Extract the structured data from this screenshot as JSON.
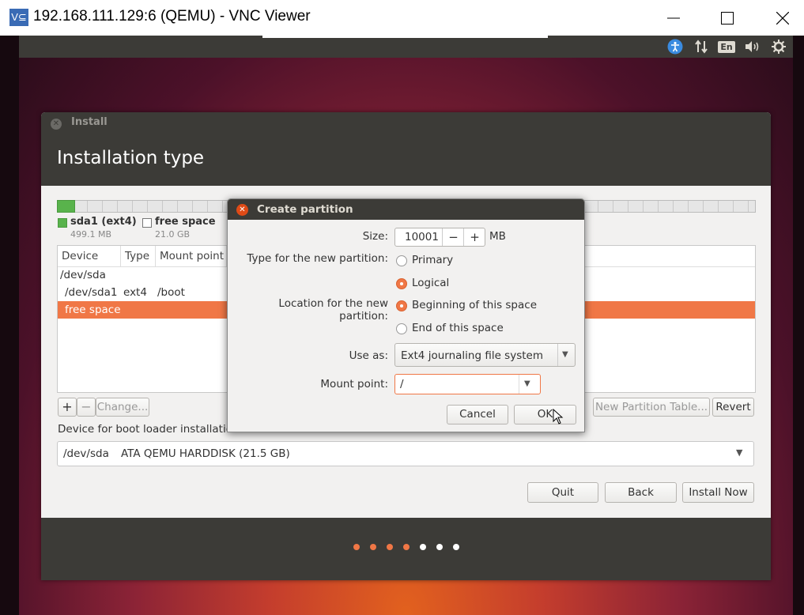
{
  "window": {
    "logo_text": "V⊆",
    "title": "192.168.111.129:6 (QEMU) - VNC Viewer"
  },
  "vm_topbar": {
    "icons": [
      "accessibility-icon",
      "network-icon",
      "keyboard-layout-icon",
      "volume-icon",
      "power-gear-icon"
    ],
    "keyboard_layout": "En"
  },
  "installer": {
    "window_title": "Install",
    "page_title": "Installation type",
    "disk_usage_fraction": 0.024,
    "legend": [
      {
        "name": "sda1 (ext4)",
        "size": "499.1 MB",
        "color": "#59b34c"
      },
      {
        "name": "free space",
        "size": "21.0 GB",
        "color": "#ffffff"
      }
    ],
    "table": {
      "headers": [
        "Device",
        "Type",
        "Mount point"
      ],
      "rows": [
        {
          "device": "/dev/sda",
          "type": "",
          "mount": ""
        },
        {
          "device": "/dev/sda1",
          "type": "ext4",
          "mount": "/boot"
        },
        {
          "device": "free space",
          "type": "",
          "mount": "",
          "selected": true
        }
      ]
    },
    "buttons": {
      "add": "+",
      "remove": "−",
      "change": "Change...",
      "new_partition_table": "New Partition Table...",
      "revert": "Revert"
    },
    "boot_loader_label": "Device for boot loader installation:",
    "boot_loader_device": "/dev/sda",
    "boot_loader_desc": "ATA QEMU HARDDISK (21.5 GB)",
    "nav": {
      "quit": "Quit",
      "back": "Back",
      "install_now": "Install Now"
    },
    "progress_dots": {
      "total": 7,
      "completed": 4,
      "active_color": "#f07746",
      "inactive_color": "#ffffff"
    }
  },
  "dialog": {
    "title": "Create partition",
    "size_label": "Size:",
    "size_value": "10001",
    "size_unit": "MB",
    "minus": "−",
    "plus": "+",
    "type_label": "Type for the new partition:",
    "type_options": [
      "Primary",
      "Logical"
    ],
    "type_selected": "Logical",
    "location_label": "Location for the new partition:",
    "location_options": [
      "Beginning of this space",
      "End of this space"
    ],
    "location_selected": "Beginning of this space",
    "use_as_label": "Use as:",
    "use_as_value": "Ext4 journaling file system",
    "mount_label": "Mount point:",
    "mount_value": "/",
    "cancel": "Cancel",
    "ok": "OK"
  }
}
